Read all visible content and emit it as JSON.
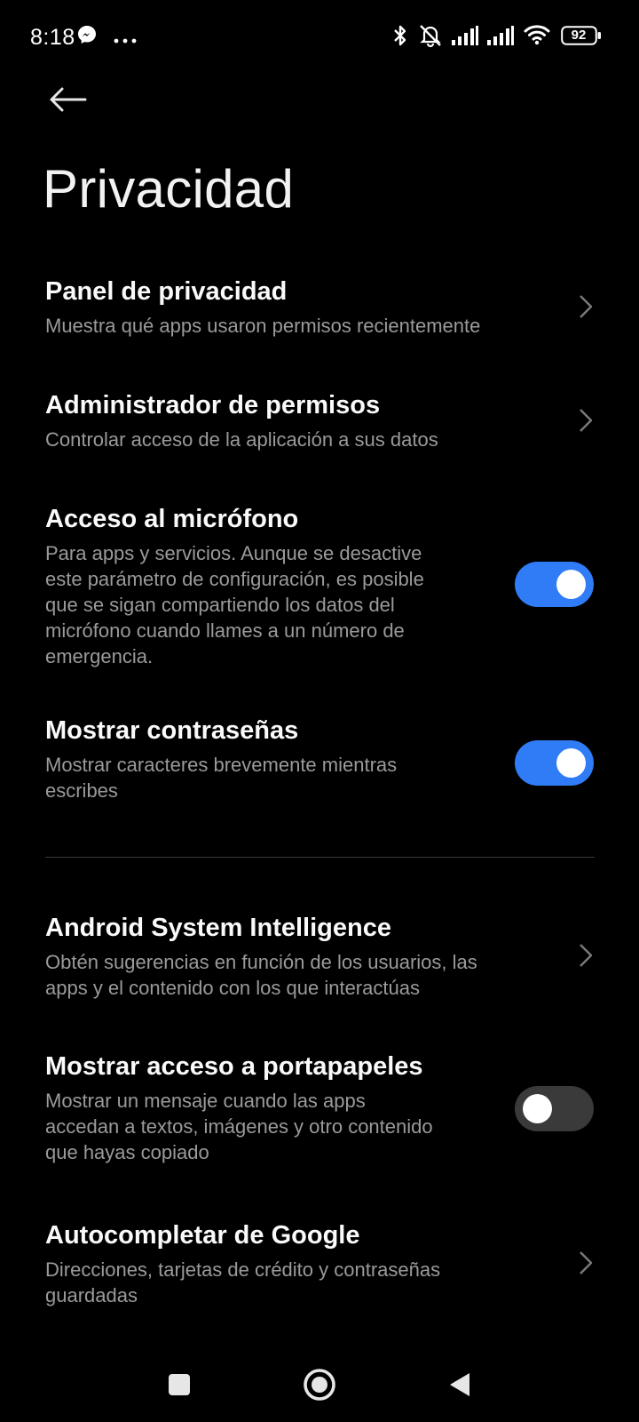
{
  "status_bar": {
    "time": "8:18",
    "battery": "92",
    "icons": [
      "messenger-icon",
      "more-dots-icon",
      "bluetooth-icon",
      "silent-icon",
      "signal-icon",
      "signal-icon",
      "wifi-icon",
      "battery-icon"
    ]
  },
  "header": {
    "title": "Privacidad",
    "back_icon": "back-arrow-icon"
  },
  "items": [
    {
      "title": "Panel de privacidad",
      "subtitle": "Muestra qué apps usaron permisos recientemente",
      "control": "chevron"
    },
    {
      "title": "Administrador de permisos",
      "subtitle": "Controlar acceso de la aplicación a sus datos",
      "control": "chevron"
    },
    {
      "title": "Acceso al micrófono",
      "subtitle_lines": [
        "Para apps y servicios. Aunque se desactive",
        "este parámetro de configuración, es posible",
        "que se sigan compartiendo los datos del",
        "micrófono cuando llames a un número de",
        "emergencia."
      ],
      "control": "toggle",
      "enabled": true
    },
    {
      "title": "Mostrar contraseñas",
      "subtitle_lines": [
        "Mostrar caracteres brevemente mientras",
        "escribes"
      ],
      "control": "toggle",
      "enabled": true
    },
    {
      "title": "Android System Intelligence",
      "subtitle_lines": [
        "Obtén sugerencias en función de los usuarios, las",
        "apps y el contenido con los que interactúas"
      ],
      "control": "chevron"
    },
    {
      "title": "Mostrar acceso a portapapeles",
      "subtitle_lines": [
        "Mostrar un mensaje cuando las apps",
        "accedan a textos, imágenes y otro contenido",
        "que hayas copiado"
      ],
      "control": "toggle",
      "enabled": false
    },
    {
      "title": "Autocompletar de Google",
      "subtitle_lines": [
        "Direcciones, tarjetas de crédito y contraseñas",
        "guardadas"
      ],
      "control": "chevron"
    }
  ],
  "nav": {
    "recents_icon": "recents-square-icon",
    "home_icon": "home-circle-icon",
    "back_icon": "back-triangle-icon"
  },
  "colors": {
    "background": "#000000",
    "toggle_on": "#2f7cf6",
    "toggle_off": "#3a3a3a",
    "subtitle": "#9a9a9a"
  }
}
